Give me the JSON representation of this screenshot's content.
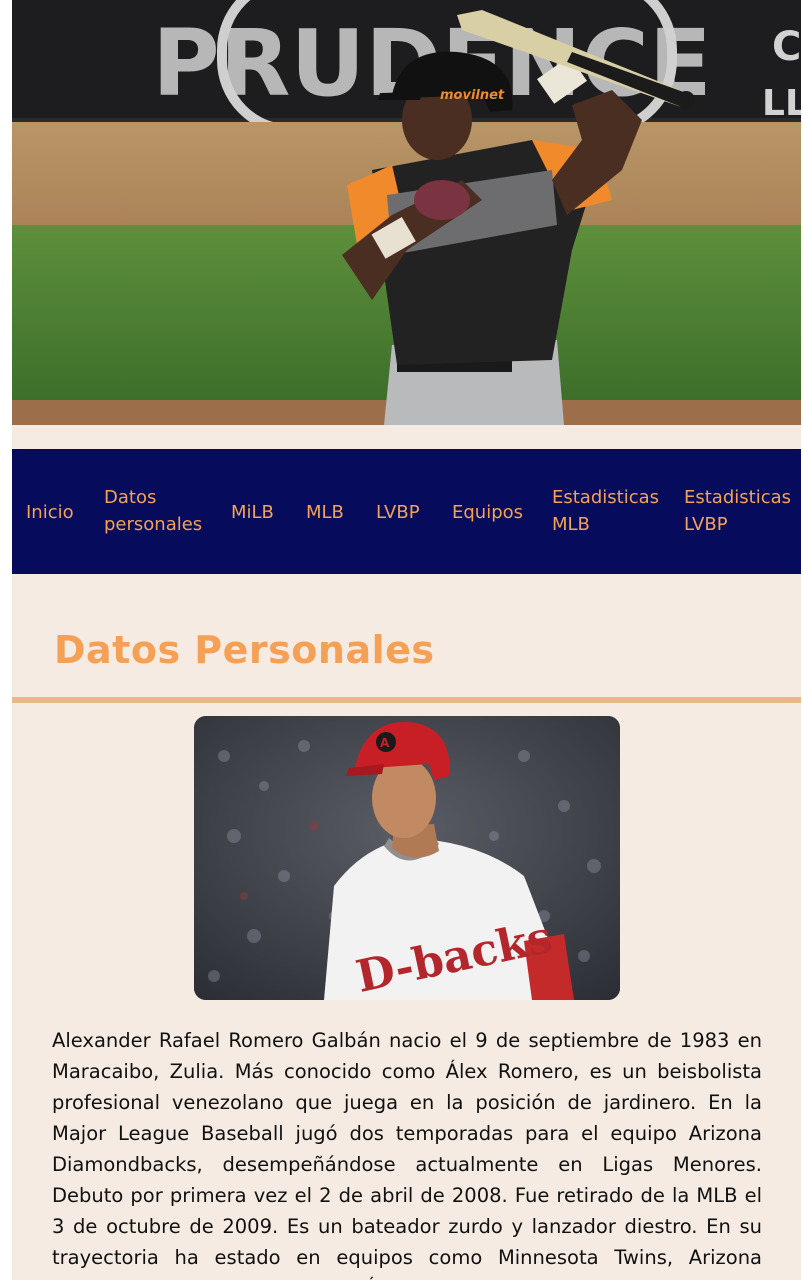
{
  "hero": {
    "banner_text": "PRUDENCE",
    "helmet_logo": "movilnet"
  },
  "nav": {
    "items": [
      {
        "label": "Inicio"
      },
      {
        "label": "Datos personales"
      },
      {
        "label": "MiLB"
      },
      {
        "label": "MLB"
      },
      {
        "label": "LVBP"
      },
      {
        "label": "Equipos"
      },
      {
        "label": "Estadisticas MLB"
      },
      {
        "label": "Estadisticas LVBP"
      }
    ]
  },
  "section": {
    "title": "Datos Personales"
  },
  "profile": {
    "jersey_text": "D-backs"
  },
  "bio": {
    "text": "Alexander Rafael Romero Galbán nacio el 9 de septiembre de 1983 en Maracaibo, Zulia. Más conocido como Álex Romero, es un beisbolista profesional venezolano que juega en la posición de jardinero. En la Major League Baseball jugó dos temporadas para el equipo Arizona Diamondbacks, desempeñándose actualmente en Ligas Menores. Debuto por primera vez el 2 de abril de 2008. Fue retirado de la MLB el 3 de octubre de 2009. Es un bateador zurdo y lanzador diestro. En su trayectoria ha estado en equipos como Minnesota Twins, Arizona Diamondbacks, Atlanta Braves, Águilas del Zulia."
  },
  "colors": {
    "page_background": "#f5ebe2",
    "nav_background": "#060b5c",
    "accent_orange": "#f3a256",
    "rule": "#e9b88a"
  }
}
